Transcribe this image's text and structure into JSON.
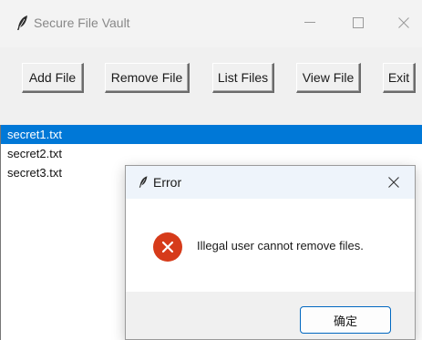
{
  "window": {
    "title": "Secure File Vault",
    "icon": "feather-icon",
    "controls": [
      "minimize-icon",
      "maximize-icon",
      "close-icon"
    ]
  },
  "toolbar": {
    "buttons": [
      {
        "label": "Add File"
      },
      {
        "label": "Remove File"
      },
      {
        "label": "List Files"
      },
      {
        "label": "View File"
      },
      {
        "label": "Exit"
      }
    ]
  },
  "file_list": {
    "items": [
      "secret1.txt",
      "secret2.txt",
      "secret3.txt"
    ],
    "selected_index": 0
  },
  "dialog": {
    "title": "Error",
    "icon": "feather-icon",
    "message_icon": "error-icon",
    "message": "Illegal user cannot remove files.",
    "ok_label": "确定"
  },
  "colors": {
    "selection": "#0078d7",
    "error_icon": "#d63b1a",
    "dialog_titlebar": "#eef4fb",
    "ok_border": "#0067c0"
  }
}
